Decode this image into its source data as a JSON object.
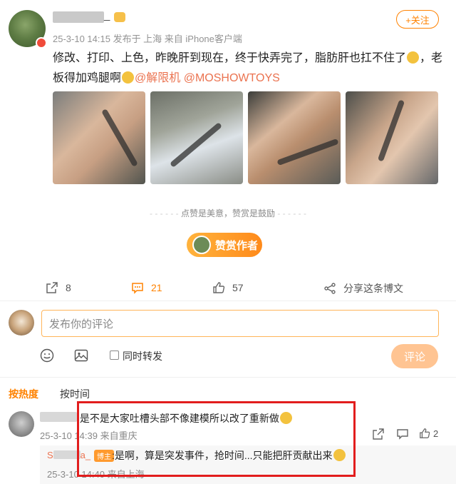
{
  "header": {
    "username_tail": "_",
    "meta": "25-3-10 14:15  发布于 上海  来自 iPhone客户端",
    "follow_label": "+关注"
  },
  "post": {
    "text_before_emoji": "修改、打印、上色，昨晚肝到现在，终于快弄完了，脂肪肝也扛不住了",
    "text_after_emoji": "，老板得加鸡腿啊",
    "mention_1": "@解限机",
    "mention_2": "@MOSHOWTOYS"
  },
  "reward": {
    "hint": "点赞是美意，赞赏是鼓励",
    "button_label": "赞赏作者"
  },
  "actions": {
    "share_count": "8",
    "comment_count": "21",
    "like_count": "57",
    "share_label": "分享这条博文"
  },
  "composer": {
    "placeholder": "发布你的评论",
    "repost_label": "同时转发",
    "submit_label": "评论"
  },
  "tabs": {
    "hot": "按热度",
    "time": "按时间"
  },
  "comments": [
    {
      "text": ":是不是大家吐槽头部不像建模所以改了重新做",
      "time": "25-3-10 14:39  来自重庆",
      "like_count": "2"
    }
  ],
  "reply": {
    "name_prefix": "S",
    "name_suffix": "a_",
    "tag": "博主",
    "text": ":是啊，算是突发事件，抢时间...只能把肝贡献出来",
    "time": "25-3-10 14:40  来自上海"
  },
  "colors": {
    "accent": "#ff8200",
    "mention": "#eb7350",
    "highlight": "#e21d1d"
  }
}
